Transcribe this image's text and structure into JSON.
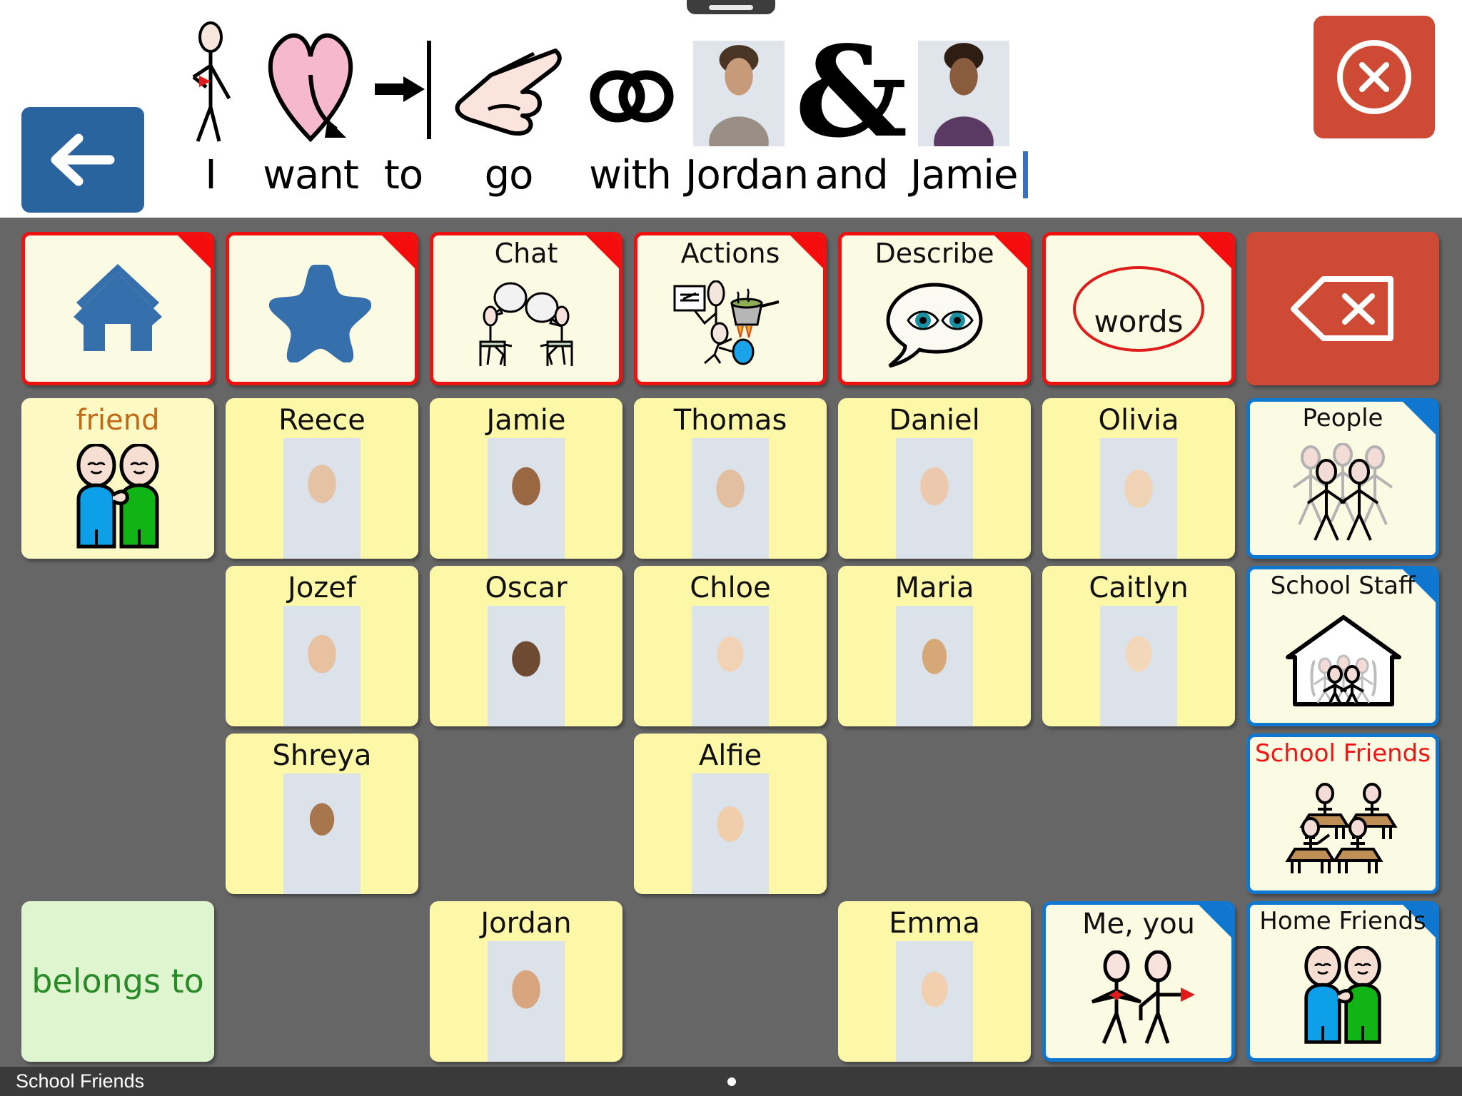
{
  "app": {
    "current_page_title": "School Friends"
  },
  "sentence": {
    "words": [
      "I",
      "want",
      "to",
      "go",
      "with",
      "Jordan",
      "and",
      "Jamie"
    ],
    "symbols": [
      {
        "name": "i-stick-figure-symbol",
        "kind": "stick-figure-self"
      },
      {
        "name": "want-heart-symbol",
        "kind": "heart-arrow"
      },
      {
        "name": "to-arrow-symbol",
        "kind": "arrow-to-line"
      },
      {
        "name": "go-pointing-hand-symbol",
        "kind": "pointing-hand"
      },
      {
        "name": "with-linked-rings-symbol",
        "kind": "linked-rings"
      },
      {
        "name": "jordan-photo-symbol",
        "kind": "photo"
      },
      {
        "name": "and-ampersand-symbol",
        "kind": "ampersand",
        "glyph": "&"
      },
      {
        "name": "jamie-photo-symbol",
        "kind": "photo"
      }
    ],
    "caret_visible": true
  },
  "back_button": {
    "label": "Back",
    "icon": "arrow-left-icon",
    "color": "#2a649f"
  },
  "close_button": {
    "label": "Close",
    "icon": "close-circle-icon",
    "color": "#cf4a35"
  },
  "nav_row": [
    {
      "label": "",
      "icon": "home-icon",
      "type": "nav"
    },
    {
      "label": "",
      "icon": "star-icon",
      "type": "nav"
    },
    {
      "label": "Chat",
      "icon": "two-people-talking-icon",
      "type": "nav"
    },
    {
      "label": "Actions",
      "icon": "actions-icon",
      "type": "nav"
    },
    {
      "label": "Describe",
      "icon": "speech-bubble-eyes-icon",
      "type": "nav"
    },
    {
      "label": "words",
      "icon": "words-oval-icon",
      "type": "nav"
    },
    {
      "label": "",
      "icon": "backspace-delete-icon",
      "type": "delete"
    }
  ],
  "grid": {
    "columns": 7,
    "rows": 4,
    "cells": [
      {
        "row": 1,
        "col": 1,
        "label": "friend",
        "type": "symbol-word",
        "label_color": "#c06a18",
        "icon": "two-friends-icon"
      },
      {
        "row": 1,
        "col": 2,
        "label": "Reece",
        "type": "person",
        "icon": "photo-reece"
      },
      {
        "row": 1,
        "col": 3,
        "label": "Jamie",
        "type": "person",
        "icon": "photo-jamie"
      },
      {
        "row": 1,
        "col": 4,
        "label": "Thomas",
        "type": "person",
        "icon": "photo-thomas"
      },
      {
        "row": 1,
        "col": 5,
        "label": "Daniel",
        "type": "person",
        "icon": "photo-daniel"
      },
      {
        "row": 1,
        "col": 6,
        "label": "Olivia",
        "type": "person",
        "icon": "photo-olivia"
      },
      {
        "row": 1,
        "col": 7,
        "label": "People",
        "type": "folder",
        "icon": "group-people-icon"
      },
      {
        "row": 2,
        "col": 2,
        "label": "Jozef",
        "type": "person",
        "icon": "photo-jozef"
      },
      {
        "row": 2,
        "col": 3,
        "label": "Oscar",
        "type": "person",
        "icon": "photo-oscar"
      },
      {
        "row": 2,
        "col": 4,
        "label": "Chloe",
        "type": "person",
        "icon": "photo-chloe"
      },
      {
        "row": 2,
        "col": 5,
        "label": "Maria",
        "type": "person",
        "icon": "photo-maria"
      },
      {
        "row": 2,
        "col": 6,
        "label": "Caitlyn",
        "type": "person",
        "icon": "photo-caitlyn"
      },
      {
        "row": 2,
        "col": 7,
        "label": "School Staff",
        "type": "folder",
        "icon": "school-building-people-icon"
      },
      {
        "row": 3,
        "col": 2,
        "label": "Shreya",
        "type": "person",
        "icon": "photo-shreya"
      },
      {
        "row": 3,
        "col": 4,
        "label": "Alfie",
        "type": "person",
        "icon": "photo-alfie"
      },
      {
        "row": 3,
        "col": 7,
        "label": "School Friends",
        "type": "folder",
        "label_color": "#f21414",
        "icon": "children-at-desks-icon",
        "is_current": true
      },
      {
        "row": 4,
        "col": 1,
        "label": "belongs to",
        "type": "plain-green"
      },
      {
        "row": 4,
        "col": 3,
        "label": "Jordan",
        "type": "person",
        "icon": "photo-jordan"
      },
      {
        "row": 4,
        "col": 5,
        "label": "Emma",
        "type": "person",
        "icon": "photo-emma"
      },
      {
        "row": 4,
        "col": 6,
        "label": "Me, you",
        "type": "folder",
        "icon": "me-you-stick-figures-icon"
      },
      {
        "row": 4,
        "col": 7,
        "label": "Home Friends",
        "type": "folder",
        "icon": "two-friends-icon"
      }
    ]
  },
  "status_bar": {
    "title": "School Friends",
    "dot": "page-indicator-dot"
  },
  "colors": {
    "grid_background": "#666666",
    "nav_border": "#ef1010",
    "folder_border": "#1077d0",
    "cell_cream": "#fbfbe4",
    "cell_yellow": "#fdf7a8",
    "accent_blue": "#2a649f",
    "accent_red": "#cf4a35",
    "green_text": "#2a8a28"
  }
}
